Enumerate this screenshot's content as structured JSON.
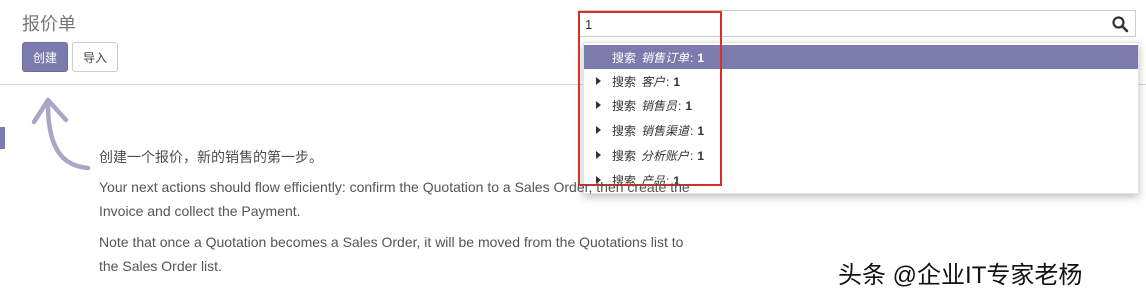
{
  "header": {
    "title": "报价单",
    "create_label": "创建",
    "import_label": "导入"
  },
  "search": {
    "value": "1",
    "icon": "search-icon"
  },
  "dropdown": {
    "items": [
      {
        "prefix": "搜索",
        "field": "销售订单",
        "value": "1",
        "active": true,
        "caret": false
      },
      {
        "prefix": "搜索",
        "field": "客户",
        "value": "1",
        "active": false,
        "caret": true
      },
      {
        "prefix": "搜索",
        "field": "销售员",
        "value": "1",
        "active": false,
        "caret": true
      },
      {
        "prefix": "搜索",
        "field": "销售渠道",
        "value": "1",
        "active": false,
        "caret": true
      },
      {
        "prefix": "搜索",
        "field": "分析账户",
        "value": "1",
        "active": false,
        "caret": true
      },
      {
        "prefix": "搜索",
        "field": "产品",
        "value": "1",
        "active": false,
        "caret": true
      }
    ]
  },
  "help": {
    "title": "创建一个报价，新的销售的第一步。",
    "p1": "Your next actions should flow efficiently: confirm the Quotation to a Sales Order, then create the Invoice and collect the Payment.",
    "p2": "Note that once a Quotation becomes a Sales Order, it will be moved from the Quotations list to the Sales Order list."
  },
  "watermark": "头条 @企业IT专家老杨",
  "colors": {
    "primary": "#7c7bad",
    "highlight_border": "#d93025"
  }
}
